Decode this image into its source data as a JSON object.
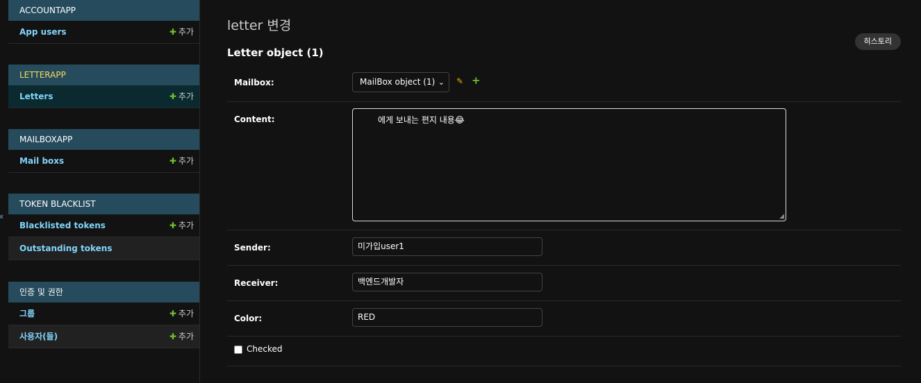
{
  "sidebar": {
    "collapse_glyph": "«",
    "modules": [
      {
        "title": "ACCOUNTAPP",
        "rows": [
          {
            "label": "App users",
            "add": "추가"
          }
        ]
      },
      {
        "title": "LETTERAPP",
        "rows": [
          {
            "label": "Letters",
            "add": "추가"
          }
        ]
      },
      {
        "title": "MAILBOXAPP",
        "rows": [
          {
            "label": "Mail boxs",
            "add": "추가"
          }
        ]
      },
      {
        "title": "TOKEN BLACKLIST",
        "rows": [
          {
            "label": "Blacklisted tokens",
            "add": "추가"
          },
          {
            "label": "Outstanding tokens",
            "add": ""
          }
        ]
      },
      {
        "title": "인증 및 권한",
        "rows": [
          {
            "label": "그룹",
            "add": "추가"
          },
          {
            "label": "사용자(들)",
            "add": "추가"
          }
        ]
      }
    ]
  },
  "main": {
    "page_title": "letter 변경",
    "history_label": "히스토리",
    "fieldset_title": "Letter object (1)",
    "fields": {
      "mailbox": {
        "label": "Mailbox:",
        "value": "MailBox object (1)"
      },
      "content": {
        "label": "Content:",
        "value": "에게 보내는 편지 내용😂"
      },
      "sender": {
        "label": "Sender:",
        "value": "미가입user1"
      },
      "receiver": {
        "label": "Receiver:",
        "value": "백엔드개발자"
      },
      "color": {
        "label": "Color:",
        "value": "RED"
      },
      "checked": {
        "label": "Checked",
        "value": false
      }
    }
  },
  "colors": {
    "background": "#121212",
    "module_header": "#264b5d",
    "link": "#81d4fa",
    "add_plus": "#70bf2b",
    "active_row": "#0a2a2f"
  }
}
